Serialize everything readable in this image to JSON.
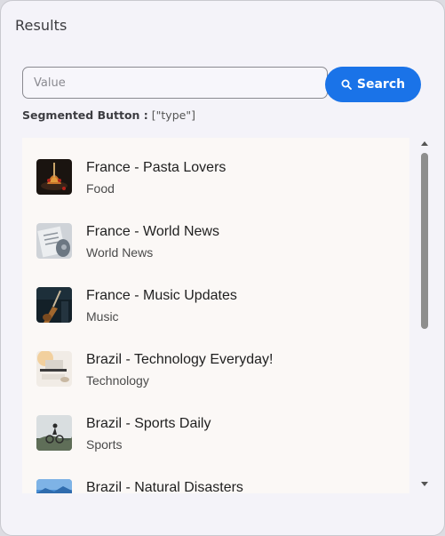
{
  "window": {
    "title": "Results"
  },
  "search": {
    "placeholder": "Value",
    "value": "",
    "button_label": "Search"
  },
  "segmented": {
    "label": "Segmented Button :",
    "value": "[\"type\"]"
  },
  "colors": {
    "accent": "#1a73e8",
    "panel": "#fbf8f6",
    "window": "#f4f3f9"
  },
  "list": {
    "items": [
      {
        "title": "France - Pasta Lovers",
        "subtitle": "Food",
        "thumbnail": "pasta-thumbnail"
      },
      {
        "title": "France - World News",
        "subtitle": "World News",
        "thumbnail": "newspaper-thumbnail"
      },
      {
        "title": "France - Music Updates",
        "subtitle": "Music",
        "thumbnail": "guitar-thumbnail"
      },
      {
        "title": "Brazil - Technology Everyday!",
        "subtitle": "Technology",
        "thumbnail": "laptop-thumbnail"
      },
      {
        "title": "Brazil - Sports Daily",
        "subtitle": "Sports",
        "thumbnail": "cyclist-thumbnail"
      },
      {
        "title": "Brazil - Natural Disasters",
        "subtitle": "",
        "thumbnail": "landscape-thumbnail"
      }
    ]
  }
}
